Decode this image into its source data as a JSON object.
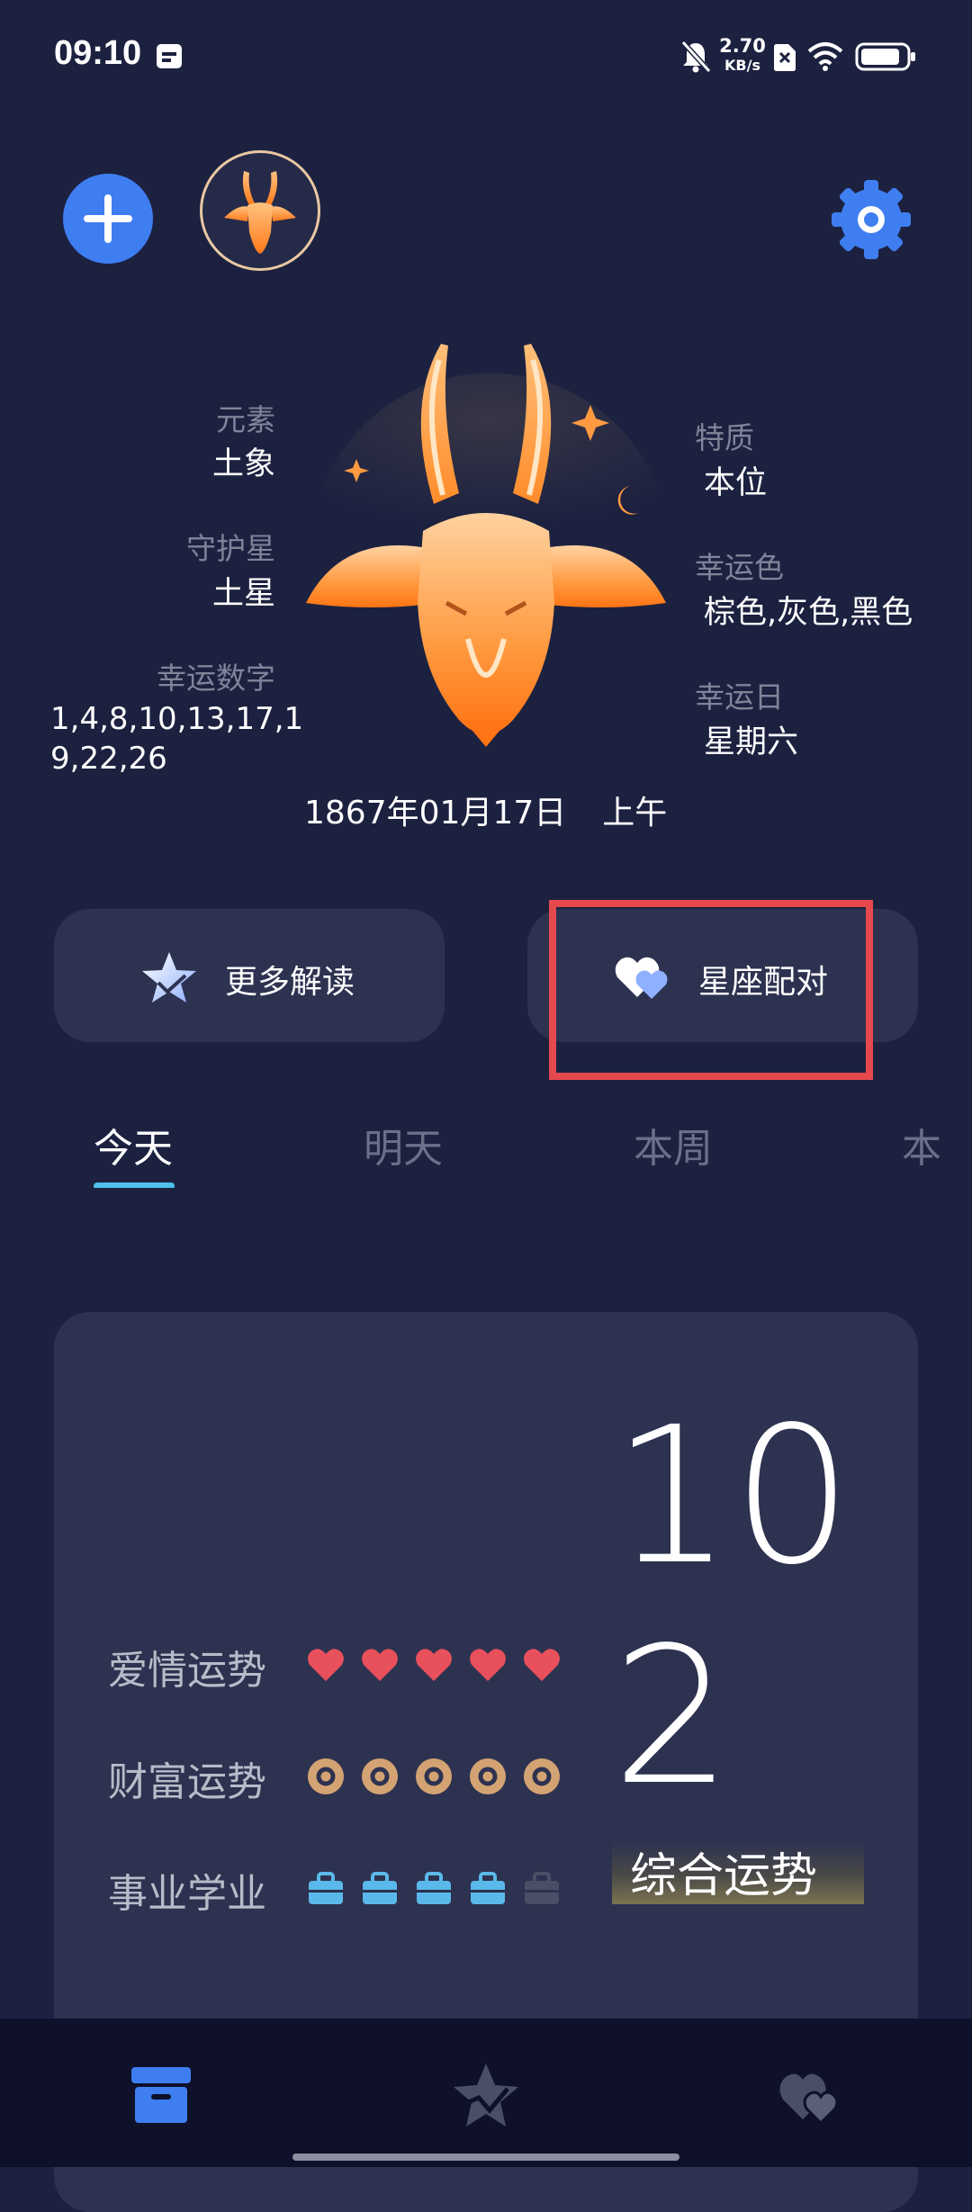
{
  "status_bar": {
    "time": "09:10",
    "net_speed_value": "2.70",
    "net_speed_unit": "KB/s",
    "icons": [
      "calendar-icon",
      "mute-icon",
      "sim-x-icon",
      "wifi-icon",
      "battery-icon"
    ]
  },
  "header": {
    "add_icon": "plus-icon",
    "avatar_icon": "capricorn-icon",
    "settings_icon": "gear-icon"
  },
  "sign_info": {
    "element_label": "元素",
    "element_value": "土象",
    "guardian_label": "守护星",
    "guardian_value": "土星",
    "lucky_number_label": "幸运数字",
    "lucky_number_line1": "1,4,8,10,13,17,1",
    "lucky_number_line2": "9,22,26",
    "trait_label": "特质",
    "trait_value": "本位",
    "lucky_color_label": "幸运色",
    "lucky_color_value": "棕色,灰色,黑色",
    "lucky_day_label": "幸运日",
    "lucky_day_value": "星期六",
    "birth_date": "1867年01月17日",
    "birth_period": "上午"
  },
  "actions": {
    "more_reading": "更多解读",
    "match": "星座配对"
  },
  "tabs": [
    {
      "label": "今天",
      "active": true
    },
    {
      "label": "明天",
      "active": false
    },
    {
      "label": "本周",
      "active": false
    },
    {
      "label": "本月",
      "active": false
    }
  ],
  "fortune_card": {
    "date_number_1": "10",
    "date_number_2": "2",
    "summary_label": "综合运势",
    "love_label": "爱情运势",
    "love_level": 5,
    "wealth_label": "财富运势",
    "wealth_level": 5,
    "career_label": "事业学业",
    "career_level": 4,
    "max_level": 5
  },
  "colors": {
    "background": "#1c2140",
    "card": "#2d3250",
    "accent_blue": "#3e7ef0",
    "tab_indicator": "#4dc1e8",
    "heart": "#e8505b",
    "coin": "#d4a373",
    "briefcase": "#5bb8ea",
    "highlight_box": "#e5484d"
  },
  "bottom_nav": [
    "box-icon",
    "star-chart-icon",
    "hearts-icon"
  ]
}
